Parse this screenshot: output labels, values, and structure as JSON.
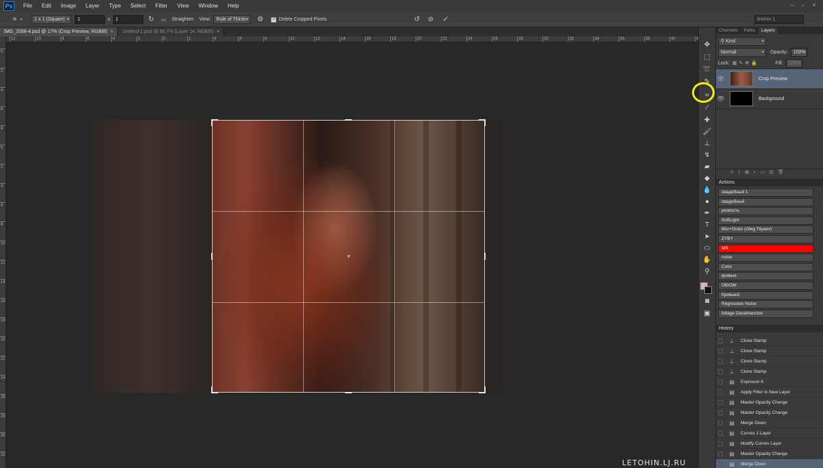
{
  "app": {
    "logo": "Ps",
    "menus": [
      "File",
      "Edit",
      "Image",
      "Layer",
      "Type",
      "Select",
      "Filter",
      "View",
      "Window",
      "Help"
    ]
  },
  "options": {
    "ratio": "1 x 1 (Square)",
    "width": "1",
    "x_sep": "x",
    "height": "1",
    "straighten": "Straighten",
    "view_label": "View:",
    "view_value": "Rule of Thirds",
    "delete_cropped": "Delete Cropped Pixels",
    "workspace": "letohin 1"
  },
  "tabs": [
    {
      "label": "IMG_2098-4.psd @ 17% (Crop Preview, RGB/8)",
      "close": "×"
    },
    {
      "label": "Untitled-1.psd @ 66,7% (Layer 14, RGB/8)",
      "close": "×"
    }
  ],
  "ruler_top": [
    "12",
    "10",
    "8",
    "6",
    "4",
    "2",
    "0",
    "2",
    "4",
    "6",
    "8",
    "10",
    "12",
    "14",
    "16",
    "18",
    "20",
    "22",
    "24",
    "26",
    "28",
    "30",
    "32",
    "34",
    "36",
    "38",
    "40",
    "42"
  ],
  "ruler_left": [
    "0",
    "2",
    "4",
    "6",
    "8",
    "0",
    "2",
    "4",
    "6",
    "8",
    "10",
    "12",
    "14",
    "16",
    "18",
    "20",
    "22",
    "24",
    "26",
    "28",
    "30",
    "32",
    "34"
  ],
  "layers_panel": {
    "tabs": [
      "Channels",
      "Paths",
      "Layers"
    ],
    "kind": "Kind",
    "blend": "Normal",
    "opacity_label": "Opacity:",
    "opacity": "100%",
    "lock_label": "Lock:",
    "fill_label": "Fill:",
    "fill": "100%",
    "layers": [
      {
        "name": "Crop Preview",
        "active": true
      },
      {
        "name": "Background",
        "active": false
      }
    ]
  },
  "actions_panel": {
    "title": "Actions",
    "items": [
      "свадебный 1",
      "свадебный",
      "резкость",
      "SoftLight",
      "Blur+Grain (Oleg Tityaev)",
      "ZYBY",
      "MS",
      "noise",
      "Color",
      "кривые",
      "OBIOM",
      "Кривые3",
      "Regressive Noise",
      "foliage Davidnanchin"
    ]
  },
  "history_panel": {
    "title": "History",
    "items": [
      "Clone Stamp",
      "Clone Stamp",
      "Clone Stamp",
      "Clone Stamp",
      "Exposure 6",
      "Apply Filter in New Layer",
      "Master Opacity Change",
      "Master Opacity Change",
      "Merge Down",
      "Curves 1 Layer",
      "Modify Curves Layer",
      "Master Opacity Change",
      "Merge Down"
    ]
  },
  "colors": {
    "foreground": "#dcb3b8",
    "background": "#111111",
    "highlight": "#f5f000",
    "selected_action": "#ff0000"
  },
  "watermark": "LETOHIN.LJ.RU"
}
